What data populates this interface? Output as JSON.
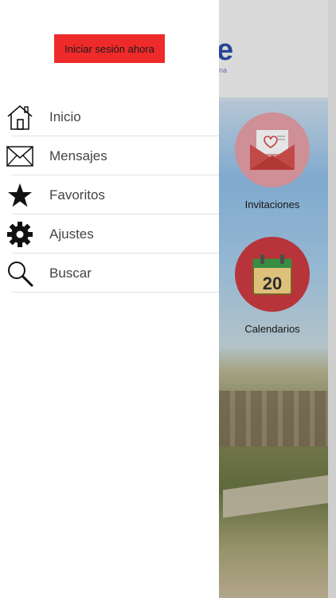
{
  "drawer": {
    "login_button": "Iniciar sesión ahora",
    "items": [
      {
        "label": "Inicio",
        "icon": "home-icon"
      },
      {
        "label": "Mensajes",
        "icon": "envelope-icon"
      },
      {
        "label": "Favoritos",
        "icon": "star-icon"
      },
      {
        "label": "Ajustes",
        "icon": "gear-icon"
      },
      {
        "label": "Buscar",
        "icon": "search-icon"
      }
    ]
  },
  "background": {
    "logo_text": "e",
    "logo_subtext": "na",
    "tiles": [
      {
        "label": "Invitaciones",
        "icon": "invitation-envelope-icon"
      },
      {
        "label": "Calendarios",
        "icon": "calendar-icon",
        "day": "20"
      }
    ]
  },
  "colors": {
    "login_button_bg": "#ee2a2a",
    "invitation_circle": "#e6a0a7",
    "calendar_circle": "#cc3a41",
    "logo": "#2d4fa8"
  }
}
